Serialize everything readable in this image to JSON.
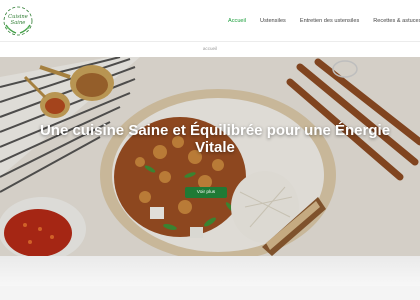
{
  "brand": {
    "logo_text": "Cuisine Saine",
    "colors": {
      "primary": "#1a9e3a",
      "button": "#1f7a35",
      "text": "#444444"
    }
  },
  "nav": {
    "items": [
      {
        "label": "Accueil",
        "active": true
      },
      {
        "label": "Ustensiles",
        "active": false
      },
      {
        "label": "Entretien des ustensiles",
        "active": false
      },
      {
        "label": "Recettes & astuces",
        "active": false
      }
    ]
  },
  "breadcrumb": {
    "label": "accueil"
  },
  "hero": {
    "title": "Une cuisine Saine et Équilibrée pour une Énergie Vitale",
    "button_label": "Voir plus"
  }
}
